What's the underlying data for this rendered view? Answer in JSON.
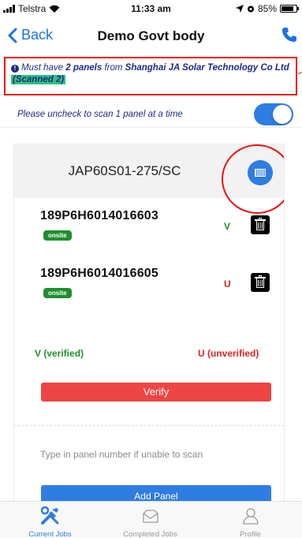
{
  "status_bar": {
    "carrier": "Telstra",
    "time": "11:33 am",
    "battery": "85%"
  },
  "nav": {
    "back_label": "Back",
    "title": "Demo Govt body"
  },
  "notice": {
    "prefix": "Must have ",
    "count_text": "2 panels",
    "middle": " from ",
    "manufacturer": "Shanghai JA Solar Technology Co Ltd",
    "scanned": "(Scanned 2)"
  },
  "scan_option": {
    "text": "Please uncheck to scan 1 panel at a time",
    "toggle_on": true
  },
  "model": {
    "name": "JAP60S01-275/SC"
  },
  "panels": [
    {
      "serial": "189P6H6014016603",
      "badge": "onsite",
      "status": "V",
      "status_color": "#1e8f2e"
    },
    {
      "serial": "189P6H6014016605",
      "badge": "onsite",
      "status": "U",
      "status_color": "#d22222"
    }
  ],
  "legend": {
    "verified": "V (verified)",
    "unverified": "U (unverified)"
  },
  "actions": {
    "verify_label": "Verify",
    "input_placeholder": "Type in panel number if unable to scan",
    "add_label": "Add Panel"
  },
  "tabs": [
    {
      "label": "Current Jobs",
      "icon": "tools-icon",
      "active": true
    },
    {
      "label": "Completed Jobs",
      "icon": "envelope-icon",
      "active": false
    },
    {
      "label": "Profile",
      "icon": "person-icon",
      "active": false
    }
  ],
  "colors": {
    "accent": "#2d7de3",
    "verified": "#1e8f2e",
    "unverified": "#d22222",
    "danger": "#ef4444"
  }
}
